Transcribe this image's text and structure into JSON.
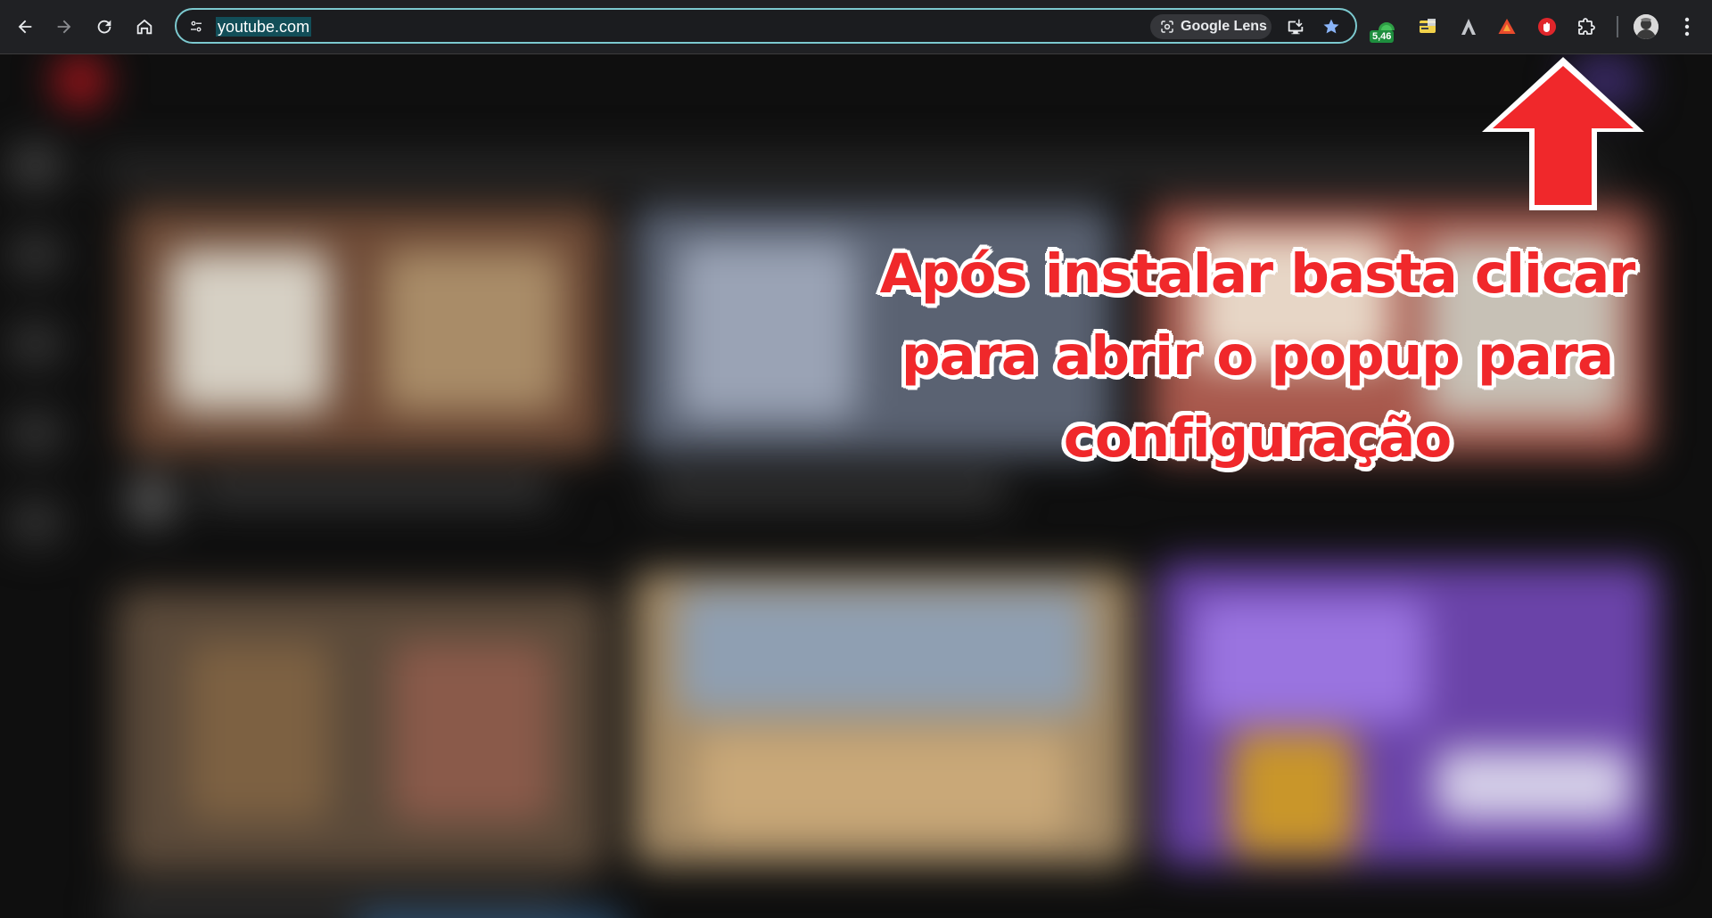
{
  "browser": {
    "omnibox": {
      "url": "youtube.com",
      "lens_label": "Google Lens"
    },
    "extensions": {
      "badge_text": "5,46"
    }
  },
  "annotation": {
    "lines": [
      "Após instalar basta clicar",
      "para abrir o popup para",
      "configuração"
    ],
    "color": "#f0282b",
    "outline_color": "#ffffff"
  },
  "colors": {
    "toolbar_bg": "#202124",
    "omnibox_border": "#7cc9cf",
    "url_highlight": "#124e58",
    "page_bg": "#0f0f0f"
  },
  "icons": [
    "back-arrow-icon",
    "forward-arrow-icon",
    "reload-icon",
    "home-icon",
    "site-info-icon",
    "google-lens-icon",
    "install-app-icon",
    "bookmark-star-icon",
    "extension-icon",
    "puzzle-extensions-icon",
    "kebab-menu-icon",
    "annotation-arrow-up-icon"
  ]
}
